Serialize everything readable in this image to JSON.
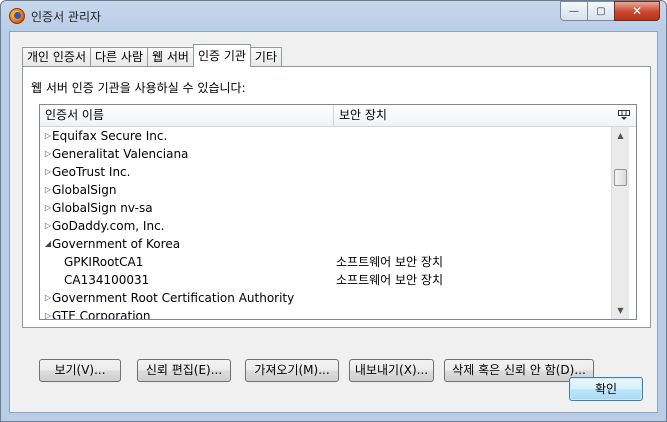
{
  "window": {
    "title": "인증서 관리자",
    "app_icon": "firefox-icon"
  },
  "caption_buttons": {
    "minimize": "—",
    "maximize": "▢",
    "close": "✕"
  },
  "tabs": [
    {
      "label": "개인 인증서",
      "active": false
    },
    {
      "label": "다른 사람",
      "active": false
    },
    {
      "label": "웹 서버",
      "active": false
    },
    {
      "label": "인증 기관",
      "active": true
    },
    {
      "label": "기타",
      "active": false
    }
  ],
  "description": "웹 서버 인증 기관을 사용하실 수 있습니다:",
  "tree": {
    "columns": {
      "name": "인증서 이름",
      "device": "보안 장치"
    },
    "rows": [
      {
        "name": "Equifax Secure Inc.",
        "device": "",
        "level": 1,
        "twisty": "▷"
      },
      {
        "name": "Generalitat Valenciana",
        "device": "",
        "level": 1,
        "twisty": "▷"
      },
      {
        "name": "GeoTrust Inc.",
        "device": "",
        "level": 1,
        "twisty": "▷"
      },
      {
        "name": "GlobalSign",
        "device": "",
        "level": 1,
        "twisty": "▷"
      },
      {
        "name": "GlobalSign nv-sa",
        "device": "",
        "level": 1,
        "twisty": "▷"
      },
      {
        "name": "GoDaddy.com, Inc.",
        "device": "",
        "level": 1,
        "twisty": "▷"
      },
      {
        "name": "Government of Korea",
        "device": "",
        "level": 1,
        "twisty": "◢"
      },
      {
        "name": "GPKIRootCA1",
        "device": "소프트웨어 보안 장치",
        "level": 2,
        "twisty": ""
      },
      {
        "name": "CA134100031",
        "device": "소프트웨어 보안 장치",
        "level": 2,
        "twisty": ""
      },
      {
        "name": "Government Root Certification Authority",
        "device": "",
        "level": 1,
        "twisty": "▷"
      },
      {
        "name": "GTE Corporation",
        "device": "",
        "level": 1,
        "twisty": "▷"
      }
    ]
  },
  "buttons": {
    "view": "보기(V)...",
    "edit_trust": "신뢰 편집(E)...",
    "import": "가져오기(M)...",
    "export": "내보내기(X)...",
    "delete": "삭제 혹은 신뢰 안 함(D)...",
    "ok": "확인"
  }
}
